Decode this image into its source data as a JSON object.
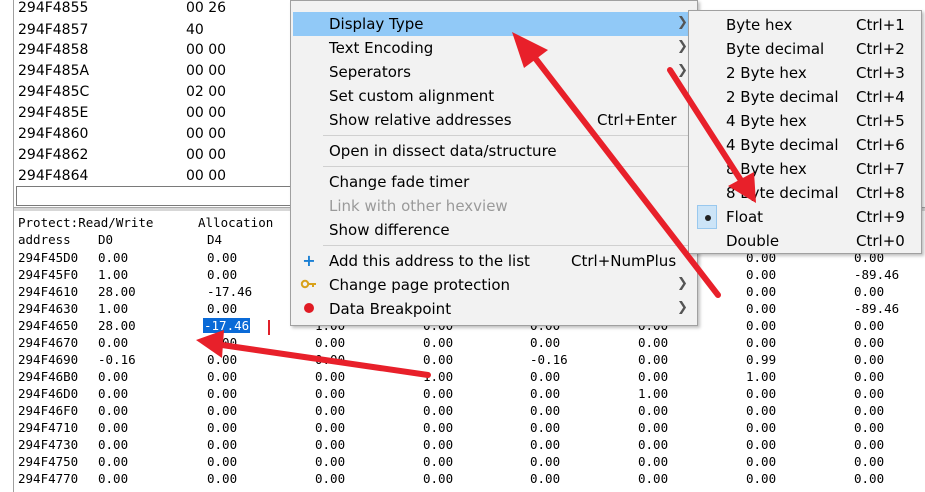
{
  "top_list": {
    "rows": [
      {
        "address": "294F4855",
        "value": "00 26"
      },
      {
        "address": "294F4857",
        "value": "40"
      },
      {
        "address": "294F4858",
        "value": "00 00"
      },
      {
        "address": "294F485A",
        "value": "00 00"
      },
      {
        "address": "294F485C",
        "value": "02 00"
      },
      {
        "address": "294F485E",
        "value": "00 00"
      },
      {
        "address": "294F4860",
        "value": "00 00"
      },
      {
        "address": "294F4862",
        "value": "00 00"
      },
      {
        "address": "294F4864",
        "value": "00 00"
      }
    ]
  },
  "hex_view": {
    "protect_label": "Protect:Read/Write",
    "allocation_label": "Allocation",
    "address_header": "address",
    "col_headers": [
      "D0",
      "D4"
    ],
    "selected_value": "-17.46",
    "rows": [
      {
        "address": "294F45D0",
        "cells": [
          "0.00",
          "0.00",
          "",
          "",
          "",
          "",
          "0.00",
          "0.00"
        ]
      },
      {
        "address": "294F45F0",
        "cells": [
          "1.00",
          "0.00",
          "",
          "",
          "",
          "",
          "0.00",
          "-89.46"
        ]
      },
      {
        "address": "294F4610",
        "cells": [
          "28.00",
          "-17.46",
          "",
          "",
          "",
          "",
          "0.00",
          "0.00"
        ]
      },
      {
        "address": "294F4630",
        "cells": [
          "1.00",
          "0.00",
          "",
          "",
          "",
          "",
          "0.00",
          "-89.46"
        ]
      },
      {
        "address": "294F4650",
        "cells": [
          "28.00",
          "",
          "1.00",
          "0.00",
          "0.00",
          "0.00",
          "0.00",
          "0.00"
        ]
      },
      {
        "address": "294F4670",
        "cells": [
          "0.00",
          "0.00",
          "0.00",
          "0.00",
          "0.00",
          "0.00",
          "0.00",
          "0.00"
        ]
      },
      {
        "address": "294F4690",
        "cells": [
          "-0.16",
          "0.00",
          "0.00",
          "0.00",
          "-0.16",
          "0.00",
          "0.99",
          "0.00"
        ]
      },
      {
        "address": "294F46B0",
        "cells": [
          "0.00",
          "0.00",
          "0.00",
          "1.00",
          "0.00",
          "0.00",
          "1.00",
          "0.00"
        ]
      },
      {
        "address": "294F46D0",
        "cells": [
          "0.00",
          "0.00",
          "0.00",
          "0.00",
          "0.00",
          "1.00",
          "0.00",
          "0.00"
        ]
      },
      {
        "address": "294F46F0",
        "cells": [
          "0.00",
          "0.00",
          "0.00",
          "0.00",
          "0.00",
          "0.00",
          "0.00",
          "0.00"
        ]
      },
      {
        "address": "294F4710",
        "cells": [
          "0.00",
          "0.00",
          "0.00",
          "0.00",
          "0.00",
          "0.00",
          "0.00",
          "0.00"
        ]
      },
      {
        "address": "294F4730",
        "cells": [
          "0.00",
          "0.00",
          "0.00",
          "0.00",
          "0.00",
          "0.00",
          "0.00",
          "0.00"
        ]
      },
      {
        "address": "294F4750",
        "cells": [
          "0.00",
          "0.00",
          "0.00",
          "0.00",
          "0.00",
          "0.00",
          "0.00",
          "0.00"
        ]
      },
      {
        "address": "294F4770",
        "cells": [
          "0.00",
          "0.00",
          "0.00",
          "0.00",
          "0.00",
          "0.00",
          "0.00",
          "0.00"
        ]
      }
    ]
  },
  "context_menu": {
    "display_type": "Display Type",
    "text_encoding": "Text Encoding",
    "separators": "Seperators",
    "set_custom_alignment": "Set custom alignment",
    "show_relative_addresses": "Show relative addresses",
    "show_relative_addresses_shortcut": "Ctrl+Enter",
    "open_dissect": "Open in dissect data/structure",
    "change_fade_timer": "Change fade timer",
    "link_other_hexview": "Link with other hexview",
    "show_difference": "Show difference",
    "add_address": "Add this address to the list",
    "add_address_shortcut": "Ctrl+NumPlus",
    "change_page_protection": "Change page protection",
    "data_breakpoint": "Data Breakpoint"
  },
  "display_type_submenu": {
    "items": [
      {
        "label": "Byte hex",
        "shortcut": "Ctrl+1",
        "checked": false
      },
      {
        "label": "Byte decimal",
        "shortcut": "Ctrl+2",
        "checked": false
      },
      {
        "label": "2 Byte hex",
        "shortcut": "Ctrl+3",
        "checked": false
      },
      {
        "label": "2 Byte decimal",
        "shortcut": "Ctrl+4",
        "checked": false
      },
      {
        "label": "4 Byte hex",
        "shortcut": "Ctrl+5",
        "checked": false
      },
      {
        "label": "4 Byte decimal",
        "shortcut": "Ctrl+6",
        "checked": false
      },
      {
        "label": "8 Byte hex",
        "shortcut": "Ctrl+7",
        "checked": false
      },
      {
        "label": "8 Byte decimal",
        "shortcut": "Ctrl+8",
        "checked": false
      },
      {
        "label": "Float",
        "shortcut": "Ctrl+9",
        "checked": true
      },
      {
        "label": "Double",
        "shortcut": "Ctrl+0",
        "checked": false
      }
    ]
  },
  "colors": {
    "highlight": "#91c9f7",
    "selection": "#0a6ad7",
    "annotation_arrow": "#e8202a"
  }
}
